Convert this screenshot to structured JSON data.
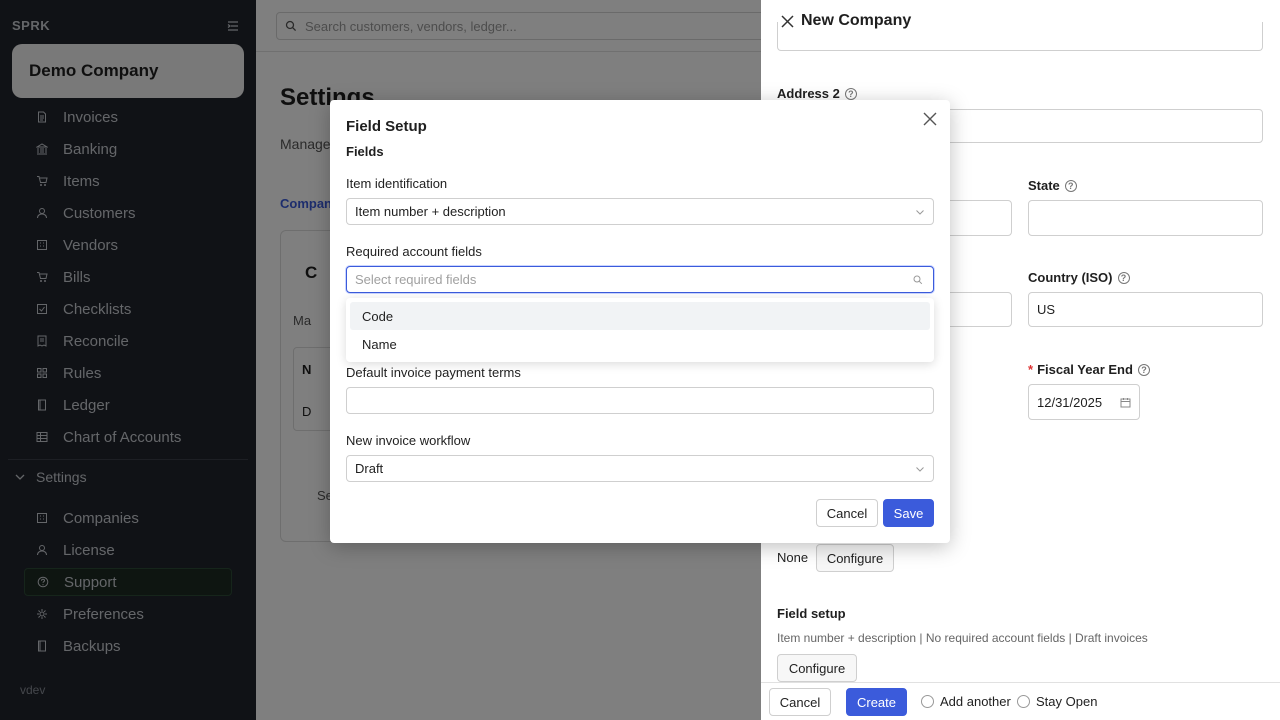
{
  "sidebar": {
    "brand": "SPRK",
    "company": "Demo Company",
    "items": [
      {
        "label": "Invoices",
        "icon": "document-icon"
      },
      {
        "label": "Banking",
        "icon": "bank-icon"
      },
      {
        "label": "Items",
        "icon": "cart-icon"
      },
      {
        "label": "Customers",
        "icon": "user-icon"
      },
      {
        "label": "Vendors",
        "icon": "building-icon"
      },
      {
        "label": "Bills",
        "icon": "cart-icon"
      },
      {
        "label": "Checklists",
        "icon": "checkbox-icon"
      },
      {
        "label": "Reconcile",
        "icon": "receipt-icon"
      },
      {
        "label": "Rules",
        "icon": "grid-icon"
      },
      {
        "label": "Ledger",
        "icon": "book-icon"
      },
      {
        "label": "Chart of Accounts",
        "icon": "table-icon"
      }
    ],
    "settings_section": "Settings",
    "settings_items": [
      {
        "label": "Companies",
        "icon": "building-icon"
      },
      {
        "label": "License",
        "icon": "user-icon"
      },
      {
        "label": "Support",
        "icon": "help-circle-icon"
      },
      {
        "label": "Preferences",
        "icon": "gear-icon"
      },
      {
        "label": "Backups",
        "icon": "book-icon"
      }
    ],
    "active_item": "Support",
    "version": "vdev"
  },
  "main": {
    "search_placeholder": "Search customers, vendors, ledger...",
    "title": "Settings",
    "subtitle": "Manage y",
    "tab": "Compani",
    "card_heading": "C",
    "card_text": "Ma",
    "card_col": "N",
    "card_cell": "D",
    "card_footer": "Se"
  },
  "drawer": {
    "title": "New Company",
    "address2_label": "Address 2",
    "state_label": "State",
    "country_label": "Country (ISO)",
    "country_value": "US",
    "fiscal_label": "Fiscal Year End",
    "fiscal_value": "12/31/2025",
    "none_label": "None",
    "configure_label": "Configure",
    "field_setup_label": "Field setup",
    "field_setup_summary": "Item number + description | No required account fields | Draft invoices",
    "footer": {
      "cancel": "Cancel",
      "create": "Create",
      "add_another": "Add another",
      "stay_open": "Stay Open"
    }
  },
  "modal": {
    "title": "Field Setup",
    "subtitle": "Fields",
    "item_identification_label": "Item identification",
    "item_identification_value": "Item number + description",
    "required_fields_label": "Required account fields",
    "required_fields_placeholder": "Select required fields",
    "required_fields_options": [
      "Code",
      "Name"
    ],
    "payment_terms_label": "Default invoice payment terms",
    "payment_terms_value": "",
    "workflow_label": "New invoice workflow",
    "workflow_value": "Draft",
    "cancel": "Cancel",
    "save": "Save"
  },
  "colors": {
    "sidebar_bg": "#20242c",
    "accent": "#3b5bdb",
    "active_bg": "#1c2a22"
  }
}
